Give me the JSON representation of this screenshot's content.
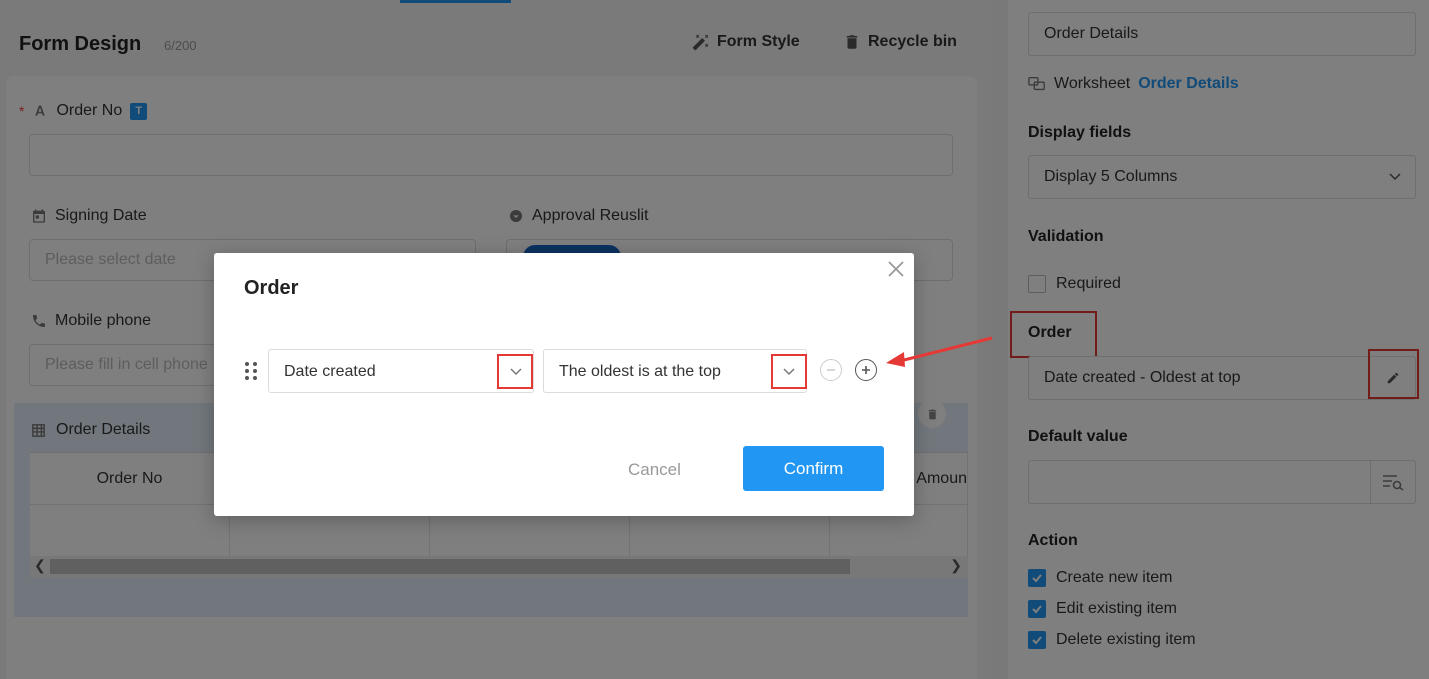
{
  "header": {
    "title": "Form Design",
    "count": "6/200",
    "form_style_label": "Form Style",
    "recycle_bin_label": "Recycle bin"
  },
  "form": {
    "order_no_label": "Order No",
    "order_no_badge": "T",
    "signing_date_label": "Signing Date",
    "signing_date_placeholder": "Please select date",
    "approval_result_label": "Approval Reuslit",
    "mobile_phone_label": "Mobile phone",
    "mobile_phone_placeholder": "Please fill in cell phone",
    "subtable": {
      "title": "Order Details",
      "columns": [
        "Order No",
        "",
        "",
        "",
        "Amoun"
      ]
    }
  },
  "right_panel": {
    "worksheet_name_value": "Order Details",
    "worksheet_label": "Worksheet",
    "worksheet_link": "Order Details",
    "display_fields_heading": "Display fields",
    "display_fields_value": "Display 5 Columns",
    "validation_heading": "Validation",
    "required_label": "Required",
    "required_checked": false,
    "order_heading": "Order",
    "order_value": "Date created - Oldest at top",
    "default_value_heading": "Default value",
    "default_value": "",
    "action_heading": "Action",
    "actions": [
      {
        "label": "Create new item",
        "checked": true
      },
      {
        "label": "Edit existing item",
        "checked": true
      },
      {
        "label": "Delete existing item",
        "checked": true
      }
    ]
  },
  "modal": {
    "title": "Order",
    "field_select": "Date created",
    "direction_select": "The oldest is at the top",
    "cancel_label": "Cancel",
    "confirm_label": "Confirm"
  },
  "colors": {
    "accent": "#2196f3",
    "annotation": "#e53935"
  },
  "icons": [
    "form-style-wand-icon",
    "recycle-bin-icon",
    "text-field-icon",
    "calendar-icon",
    "approval-icon",
    "phone-icon",
    "table-icon",
    "worksheet-icon",
    "edit-pencil-icon",
    "search-list-icon",
    "drag-handle-icon",
    "remove-circle-icon",
    "add-circle-icon",
    "close-icon",
    "chevron-down-icon"
  ]
}
